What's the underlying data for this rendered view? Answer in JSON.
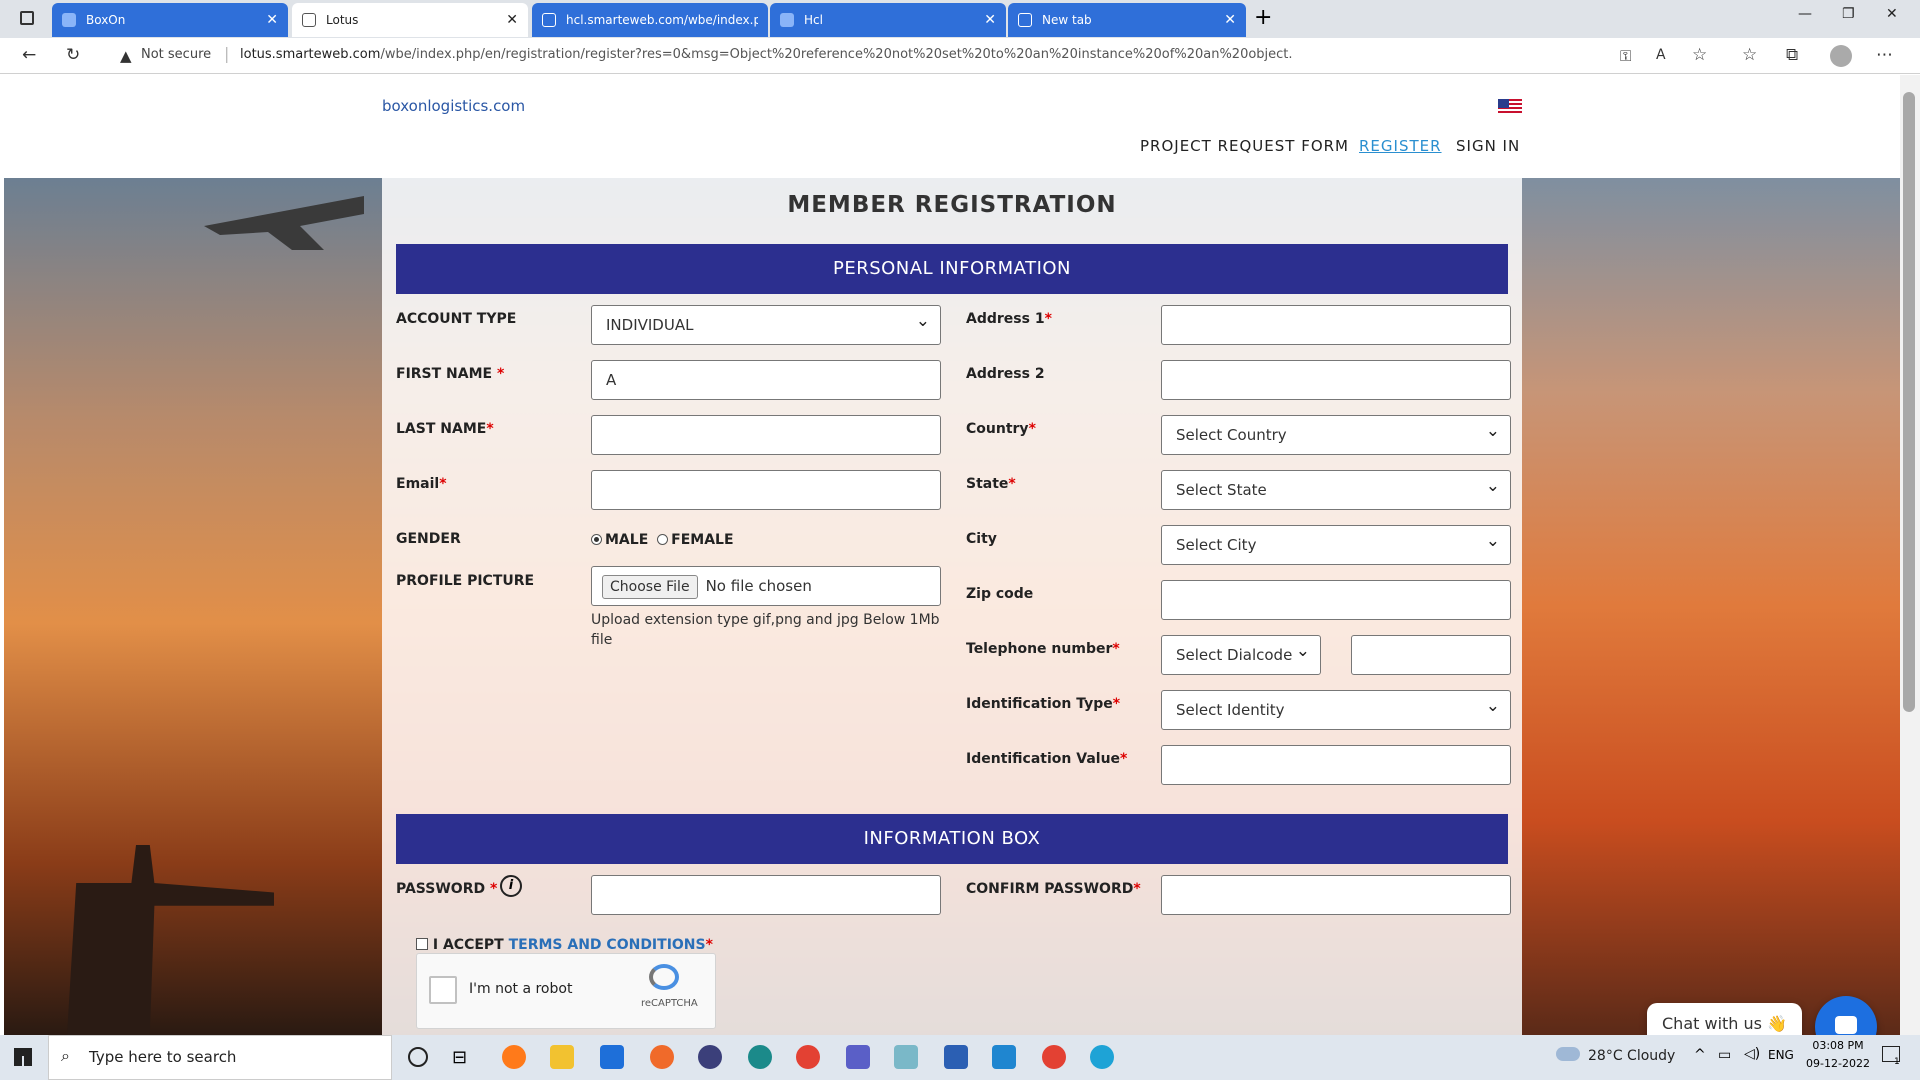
{
  "browser": {
    "tabs": [
      {
        "label": "BoxOn",
        "state": "blue"
      },
      {
        "label": "Lotus",
        "state": "active"
      },
      {
        "label": "hcl.smarteweb.com/wbe/index.p",
        "state": "blue"
      },
      {
        "label": "Hcl",
        "state": "blue"
      },
      {
        "label": "New tab",
        "state": "blue"
      }
    ],
    "not_secure": "Not secure",
    "url_host": "lotus.smarteweb.com",
    "url_path": "/wbe/index.php/en/registration/register?res=0&msg=Object%20reference%20not%20set%20to%20an%20instance%20of%20an%20object."
  },
  "header": {
    "logo_alt": "boxonlogistics.com",
    "nav": [
      "PROJECT REQUEST FORM",
      "REGISTER",
      "SIGN IN"
    ]
  },
  "form": {
    "title": "MEMBER REGISTRATION",
    "section1": "PERSONAL INFORMATION",
    "section2": "INFORMATION BOX",
    "account_type_label": "ACCOUNT TYPE",
    "account_type_value": "INDIVIDUAL",
    "first_name_label": "FIRST NAME",
    "first_name_value": "A",
    "last_name_label": "LAST NAME",
    "email_label": "Email",
    "gender_label": "GENDER",
    "gender_male": "MALE",
    "gender_female": "FEMALE",
    "profile_label": "PROFILE PICTURE",
    "choose_file": "Choose File",
    "no_file": "No file chosen",
    "upload_hint": "Upload extension type gif,png and jpg Below 1Mb file",
    "address1_label": "Address 1",
    "address2_label": "Address 2",
    "country_label": "Country",
    "country_value": "Select Country",
    "state_label": "State",
    "state_value": "Select State",
    "city_label": "City",
    "city_value": "Select City",
    "zip_label": "Zip code",
    "tel_label": "Telephone number",
    "dialcode_value": "Select Dialcode",
    "id_type_label": "Identification Type",
    "id_type_value": "Select Identity",
    "id_value_label": "Identification Value",
    "password_label": "PASSWORD",
    "confirm_label": "CONFIRM PASSWORD",
    "accept_text": "I ACCEPT",
    "terms_text": "TERMS AND CONDITIONS",
    "required_mark": "*",
    "info_icon": "i",
    "captcha_text": "I'm not a robot",
    "captcha_brand": "reCAPTCHA"
  },
  "chat": {
    "label": "Chat with us 👋"
  },
  "taskbar": {
    "search_placeholder": "Type here to search",
    "weather": "28°C  Cloudy",
    "lang": "ENG",
    "time": "03:08 PM",
    "date": "09-12-2022",
    "notif_count": "1"
  },
  "icons": [
    "sidebar-toggle-icon",
    "back-icon",
    "refresh-icon",
    "warning-icon",
    "flag-icon",
    "info-icon",
    "chat-icon",
    "windows-icon",
    "search-icon"
  ]
}
